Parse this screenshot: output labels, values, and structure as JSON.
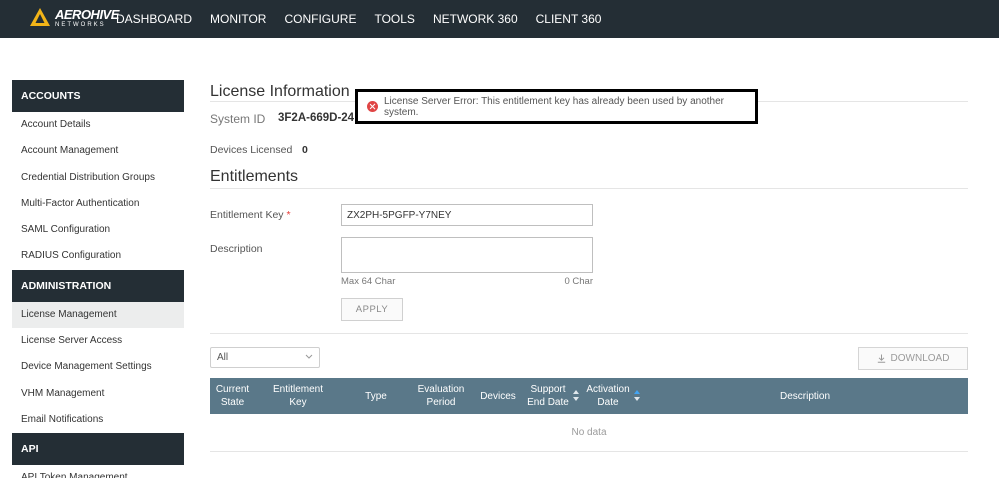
{
  "brand": {
    "name": "AEROHIVE",
    "sub": "NETWORKS"
  },
  "nav": [
    "DASHBOARD",
    "MONITOR",
    "CONFIGURE",
    "TOOLS",
    "NETWORK 360",
    "CLIENT 360"
  ],
  "sidebar": {
    "accounts": {
      "header": "ACCOUNTS",
      "items": [
        "Account Details",
        "Account Management",
        "Credential Distribution Groups",
        "Multi-Factor Authentication",
        "SAML Configuration",
        "RADIUS Configuration"
      ]
    },
    "administration": {
      "header": "ADMINISTRATION",
      "items": [
        "License Management",
        "License Server Access",
        "Device Management Settings",
        "VHM Management",
        "Email Notifications"
      ]
    },
    "api": {
      "header": "API",
      "items": [
        "API Token Management"
      ]
    }
  },
  "license": {
    "title": "License Information",
    "system_id_label": "System ID",
    "system_id_value": "3F2A-669D-24",
    "devices_licensed_label": "Devices Licensed",
    "devices_licensed_value": "0"
  },
  "entitlements": {
    "title": "Entitlements",
    "key_label": "Entitlement Key",
    "required_mark": "*",
    "key_value": "ZX2PH-5PGFP-Y7NEY",
    "description_label": "Description",
    "description_value": "",
    "max_chars": "Max 64 Char",
    "char_count": "0 Char",
    "apply_label": "APPLY"
  },
  "table": {
    "filter_value": "All",
    "download_label": "DOWNLOAD",
    "columns": {
      "current_state": "Current\nState",
      "entitlement_key": "Entitlement\nKey",
      "type": "Type",
      "evaluation_period": "Evaluation\nPeriod",
      "devices": "Devices",
      "support_end_date": "Support\nEnd Date",
      "activation_date": "Activation\nDate",
      "description": "Description"
    },
    "empty_text": "No data"
  },
  "toast": {
    "message": "License Server Error: This entitlement key has already been used by another system."
  },
  "colors": {
    "nav_bg": "#242e35",
    "table_header_bg": "#5a7889",
    "error_red": "#e04545",
    "logo_yellow": "#f2b418"
  }
}
